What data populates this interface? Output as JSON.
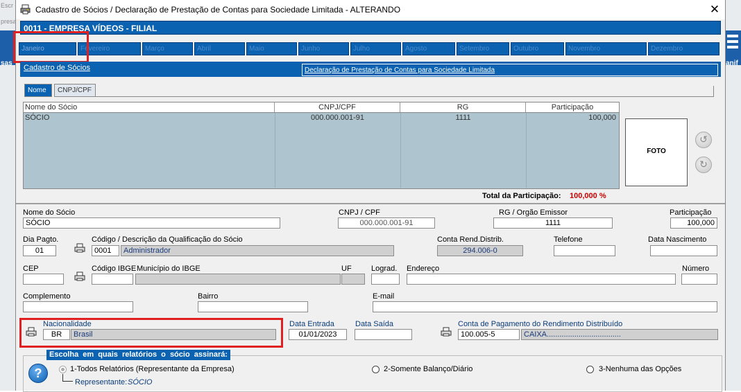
{
  "window": {
    "title": "Cadastro de Sócios / Declaração de Prestação de Contas para Sociedade Limitada   -   ALTERANDO",
    "close_glyph": "✕",
    "app_icon": "printer-icon"
  },
  "background": {
    "left_text_1": "Escr",
    "left_text_2": "presa",
    "left_text_3": "sas",
    "right_text": "anif"
  },
  "company": "0011  -  EMPRESA VÍDEOS - FILIAL",
  "months": [
    "Janeiro",
    "Fevereiro",
    "Março",
    "Abril",
    "Maio",
    "Junho",
    "Julho",
    "Agosto",
    "Setembro",
    "Outubro",
    "Novembro",
    "Dezembro"
  ],
  "subtabs": {
    "cadastro": "Cadastro de Sócios",
    "declaracao": "Declaração de Prestação de Contas para Sociedade Limitada"
  },
  "sort_tabs": [
    "Nome",
    "CNPJ/CPF"
  ],
  "table": {
    "headers": [
      "Nome do Sócio",
      "CNPJ/CPF",
      "RG",
      "Participação"
    ],
    "rows": [
      [
        "SÓCIO",
        "000.000.001-91",
        "1111",
        "100,000"
      ]
    ]
  },
  "total": {
    "label": "Total da Participação:",
    "value": "100,000  %"
  },
  "foto_label": "FOTO",
  "form": {
    "nome_label": "Nome do Sócio",
    "nome_value": "SÓCIO",
    "cnpj_label": "CNPJ / CPF",
    "cnpj_value": "000.000.001-91",
    "rg_label": "RG / Orgão Emissor",
    "rg_value": "1111",
    "participacao_label": "Participação",
    "participacao_value": "100,000",
    "dia_label": "Dia Pagto.",
    "dia_value": "01",
    "codigo_label": "Código  /  Descrição da Qualificação do Sócio",
    "codigo_value": "0001",
    "qualificacao_value": "Administrador",
    "conta_rend_label": "Conta Rend.Distrib.",
    "conta_rend_value": "294.006-0",
    "telefone_label": "Telefone",
    "telefone_value": "",
    "nascimento_label": "Data Nascimento",
    "nascimento_value": "",
    "cep_label": "CEP",
    "cep_value": "",
    "ibge_label": "Código IBGE",
    "ibge_value": "",
    "municipio_label": "Município do IBGE",
    "municipio_value": "",
    "uf_label": "UF",
    "uf_value": "",
    "lograd_label": "Lograd.",
    "lograd_value": "",
    "endereco_label": "Endereço",
    "endereco_value": "",
    "numero_label": "Número",
    "numero_value": "",
    "complemento_label": "Complemento",
    "complemento_value": "",
    "bairro_label": "Bairro",
    "bairro_value": "",
    "email_label": "E-mail",
    "email_value": "",
    "nacionalidade_label": "Nacionalidade",
    "nacionalidade_code": "BR",
    "nacionalidade_value": "Brasil",
    "entrada_label": "Data Entrada",
    "entrada_value": "01/01/2023",
    "saida_label": "Data Saída",
    "saida_value": "",
    "conta_pag_label": "Conta de Pagamento do Rendimento Distribuído",
    "conta_pag_value": "100.005-5",
    "conta_pag_desc": "CAIXA..................................."
  },
  "relatorios": {
    "title": "Escolha  em  quais  relatórios  o sócio assinará:",
    "help": "?",
    "opt1": "1-Todos Relatórios (Representante da Empresa)",
    "opt2": "2-Somente Balanço/Diário",
    "opt3": "3-Nenhuma das Opções",
    "representante_label": "Representante:",
    "representante_value": "SÓCIO"
  },
  "colors": {
    "accent": "#0a62b0",
    "highlight": "#e02020",
    "grid_bg": "#aec4ce",
    "total_value": "#cc0000"
  }
}
